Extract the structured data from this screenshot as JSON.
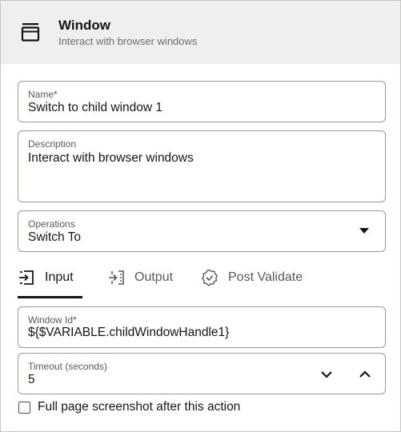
{
  "header": {
    "icon": "window-icon",
    "title": "Window",
    "subtitle": "Interact with browser windows"
  },
  "form": {
    "name": {
      "label": "Name*",
      "value": "Switch to child window 1"
    },
    "description": {
      "label": "Description",
      "value": "Interact with browser windows"
    },
    "operations": {
      "label": "Operations",
      "value": "Switch To"
    }
  },
  "tabs": [
    {
      "label": "Input",
      "icon": "input-icon",
      "active": true
    },
    {
      "label": "Output",
      "icon": "output-icon",
      "active": false
    },
    {
      "label": "Post Validate",
      "icon": "validate-badge-icon",
      "active": false
    }
  ],
  "input": {
    "window_id": {
      "label": "Window Id*",
      "value": "${$VARIABLE.childWindowHandle1}"
    },
    "timeout": {
      "label": "Timeout (seconds)",
      "value": "5"
    }
  },
  "screenshot_option": {
    "label": "Full page screenshot after this action",
    "checked": false
  },
  "colors": {
    "header_bg": "#f1efed",
    "border": "#9e9a96",
    "text": "#161513",
    "muted": "#5b5854"
  }
}
